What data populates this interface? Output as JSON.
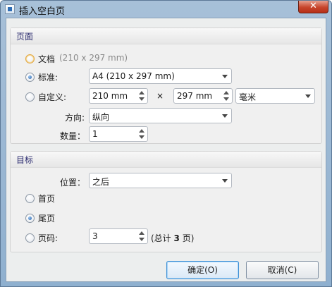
{
  "window": {
    "title": "插入空白页",
    "close_glyph": "✕"
  },
  "page_group": {
    "title": "页面",
    "doc_option": {
      "label": "文档",
      "size": "(210 x 297 mm)"
    },
    "standard_option": {
      "label": "标准:",
      "value": "A4 (210 x 297 mm)"
    },
    "custom_option": {
      "label": "自定义:",
      "width": "210 mm",
      "times": "×",
      "height": "297 mm",
      "unit": "毫米"
    },
    "orientation": {
      "label": "方向:",
      "value": "纵向"
    },
    "count": {
      "label": "数量：",
      "value": "1"
    }
  },
  "target_group": {
    "title": "目标",
    "position": {
      "label": "位置：",
      "value": "之后"
    },
    "first_option": {
      "label": "首页"
    },
    "last_option": {
      "label": "尾页"
    },
    "page_option": {
      "label": "页码:",
      "value": "3",
      "total_prefix": "(总计",
      "total_value": "3",
      "total_suffix": "页)"
    }
  },
  "buttons": {
    "ok": "确定(O)",
    "cancel": "取消(C)"
  }
}
